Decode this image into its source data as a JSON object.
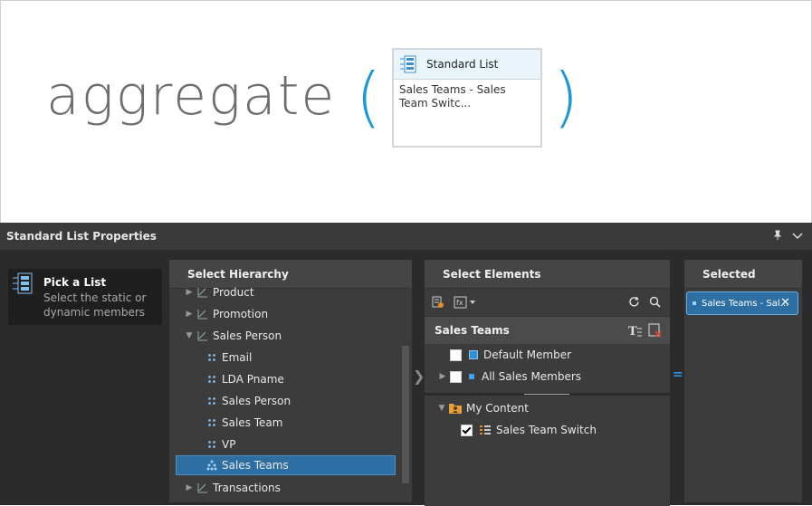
{
  "canvas": {
    "function_name": "aggregate",
    "open_paren": "(",
    "close_paren": ")",
    "card": {
      "title": "Standard List",
      "body": "Sales Teams - Sales Team Switc..."
    }
  },
  "panel": {
    "title": "Standard List Properties",
    "pin_icon": "pin-icon",
    "collapse_icon": "chevron-down-icon"
  },
  "left_nav": {
    "title": "Pick a List",
    "subtitle": "Select the static or dynamic members"
  },
  "hierarchy": {
    "header": "Select Hierarchy",
    "items": [
      {
        "label": "Product",
        "type": "hierarchy",
        "expand": "collapsed"
      },
      {
        "label": "Promotion",
        "type": "hierarchy",
        "expand": "collapsed"
      },
      {
        "label": "Sales Person",
        "type": "hierarchy",
        "expand": "expanded"
      },
      {
        "label": "Email",
        "type": "level"
      },
      {
        "label": "LDA Pname",
        "type": "level"
      },
      {
        "label": "Sales Person",
        "type": "level"
      },
      {
        "label": "Sales Team",
        "type": "level"
      },
      {
        "label": "VP",
        "type": "level"
      },
      {
        "label": "Sales Teams",
        "type": "level",
        "selected": true
      },
      {
        "label": "Transactions",
        "type": "hierarchy",
        "expand": "collapsed"
      }
    ]
  },
  "elements": {
    "header": "Select Elements",
    "section_title": "Sales Teams",
    "members": [
      {
        "label": "Default Member",
        "checked": false
      },
      {
        "label": "All Sales Members",
        "checked": false
      }
    ],
    "content_folder": "My Content",
    "content_items": [
      {
        "label": "Sales Team Switch",
        "checked": true
      }
    ]
  },
  "selected": {
    "header": "Selected",
    "chips": [
      {
        "label": "Sales Teams - Sal..."
      }
    ]
  },
  "colors": {
    "accent": "#1e96d8",
    "selection": "#2d6fa3",
    "panel_bg": "#2b2b2b"
  }
}
